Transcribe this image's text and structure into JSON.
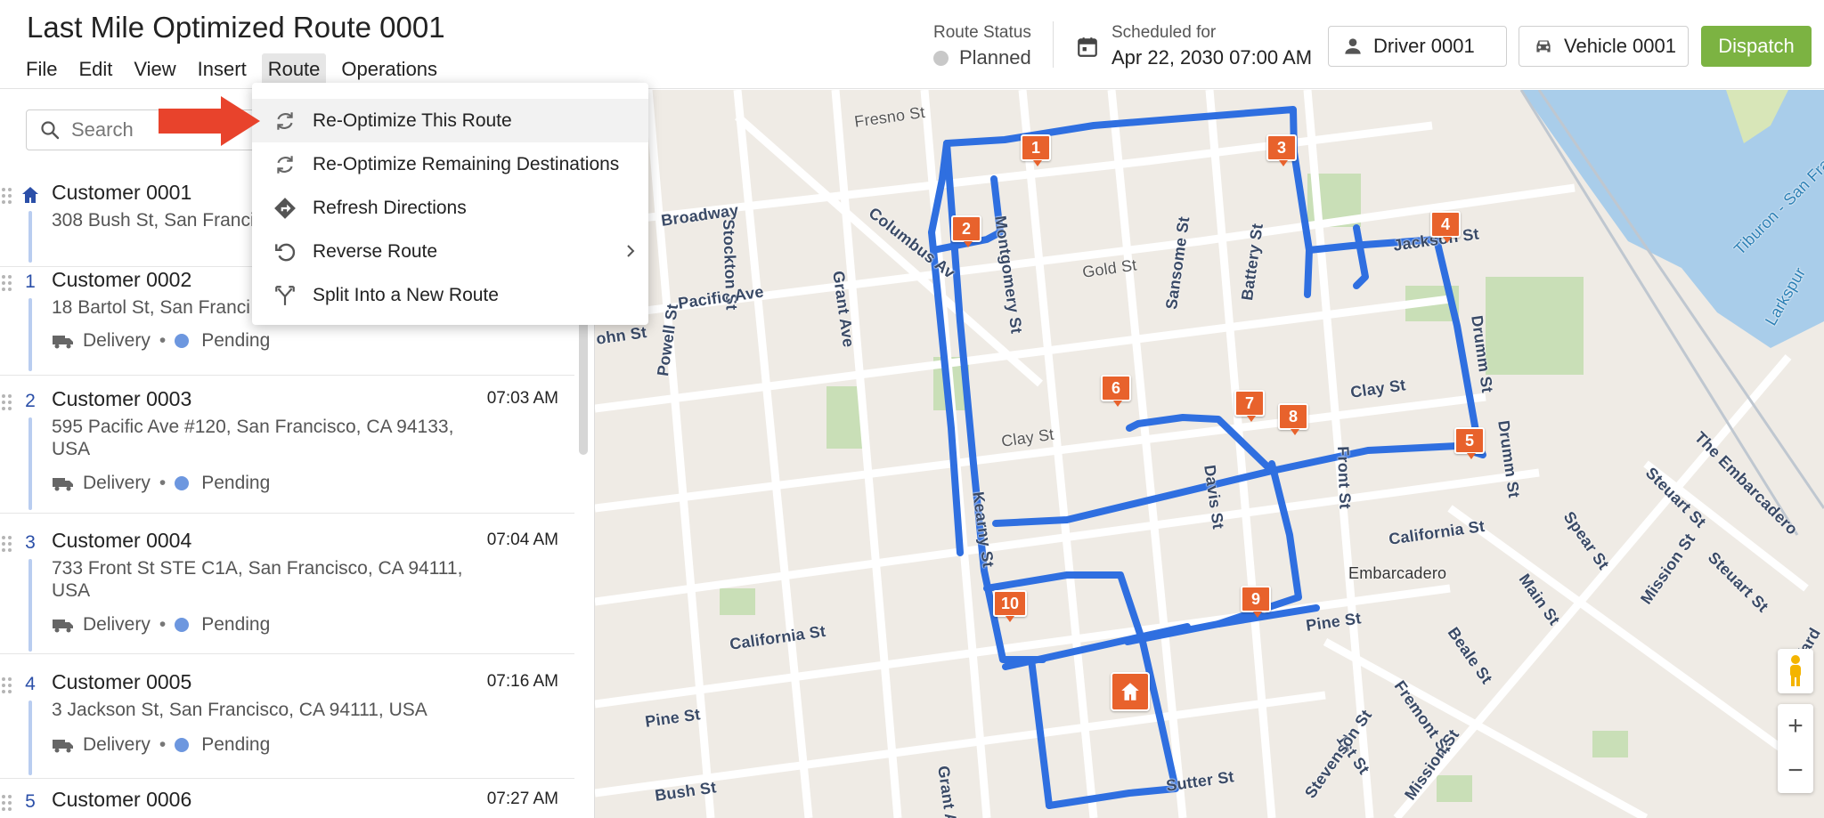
{
  "app": {
    "title": "Last Mile Optimized Route 0001"
  },
  "menu": [
    "File",
    "Edit",
    "View",
    "Insert",
    "Route",
    "Operations"
  ],
  "route_status": {
    "label": "Route Status",
    "value": "Planned"
  },
  "schedule": {
    "label": "Scheduled for",
    "value": "Apr 22, 2030 07:00 AM",
    "icon": "calendar-icon"
  },
  "driver_button": {
    "label": "Driver 0001",
    "icon": "person-icon"
  },
  "vehicle_button": {
    "label": "Vehicle 0001",
    "icon": "car-icon"
  },
  "dispatch_button": {
    "label": "Dispatch",
    "color": "#7cb342"
  },
  "search": {
    "placeholder": "Search"
  },
  "route_menu": {
    "items": [
      {
        "label": "Re-Optimize This Route",
        "icon": "refresh-icon"
      },
      {
        "label": "Re-Optimize Remaining Destinations",
        "icon": "refresh-icon"
      },
      {
        "label": "Refresh Directions",
        "icon": "directions-icon"
      },
      {
        "label": "Reverse Route",
        "icon": "undo-icon",
        "submenu": true
      },
      {
        "label": "Split Into a New Route",
        "icon": "split-icon"
      }
    ]
  },
  "stops": [
    {
      "number": "",
      "name": "Customer 0001",
      "address": "308 Bush St, San Franci",
      "eta": "",
      "type": "",
      "status": "",
      "depot": true
    },
    {
      "number": "1",
      "name": "Customer 0002",
      "address": "18 Bartol St, San Franci",
      "eta": "",
      "type": "Delivery",
      "status": "Pending"
    },
    {
      "number": "2",
      "name": "Customer 0003",
      "address": "595 Pacific Ave #120, San Francisco, CA 94133, USA",
      "eta": "07:03 AM",
      "type": "Delivery",
      "status": "Pending"
    },
    {
      "number": "3",
      "name": "Customer 0004",
      "address": "733 Front St STE C1A, San Francisco, CA 94111, USA",
      "eta": "07:04 AM",
      "type": "Delivery",
      "status": "Pending"
    },
    {
      "number": "4",
      "name": "Customer 0005",
      "address": "3 Jackson St, San Francisco, CA 94111, USA",
      "eta": "07:16 AM",
      "type": "Delivery",
      "status": "Pending"
    },
    {
      "number": "5",
      "name": "Customer 0006",
      "address": "",
      "eta": "07:27 AM",
      "type": "",
      "status": ""
    }
  ],
  "map": {
    "route_color": "#2f6fe0",
    "pin_color": "#e8622c",
    "markers": [
      "1",
      "2",
      "3",
      "4",
      "5",
      "6",
      "7",
      "8",
      "9",
      "10"
    ],
    "streets": [
      "Fresno St",
      "Stockton St",
      "Broadway",
      "Grant Ave",
      "Columbus Av",
      "Pacific Ave",
      "Gold St",
      "Sansome St",
      "Battery St",
      "ohn St",
      "Powell St",
      "Clay St",
      "Clay St",
      "Drumm St",
      "Drumm St",
      "California St",
      "California St",
      "Front St",
      "Embarcadero",
      "Pine St",
      "Pine St",
      "Bush St",
      "Sutter St",
      "Grant A",
      "Steuart St",
      "Spear St",
      "Main St",
      "Beale St",
      "Fremont St",
      "1st St",
      "Mission St",
      "Mission St",
      "Steuart St",
      "The Embarcadero",
      "Tiburon - San Franc",
      "Larkspur",
      "Ward",
      "Montgomery St",
      "Kearny St",
      "Davis St",
      "Jackson St",
      "Stevenson St",
      "Sp"
    ],
    "zoom_in": "+",
    "zoom_out": "−"
  }
}
